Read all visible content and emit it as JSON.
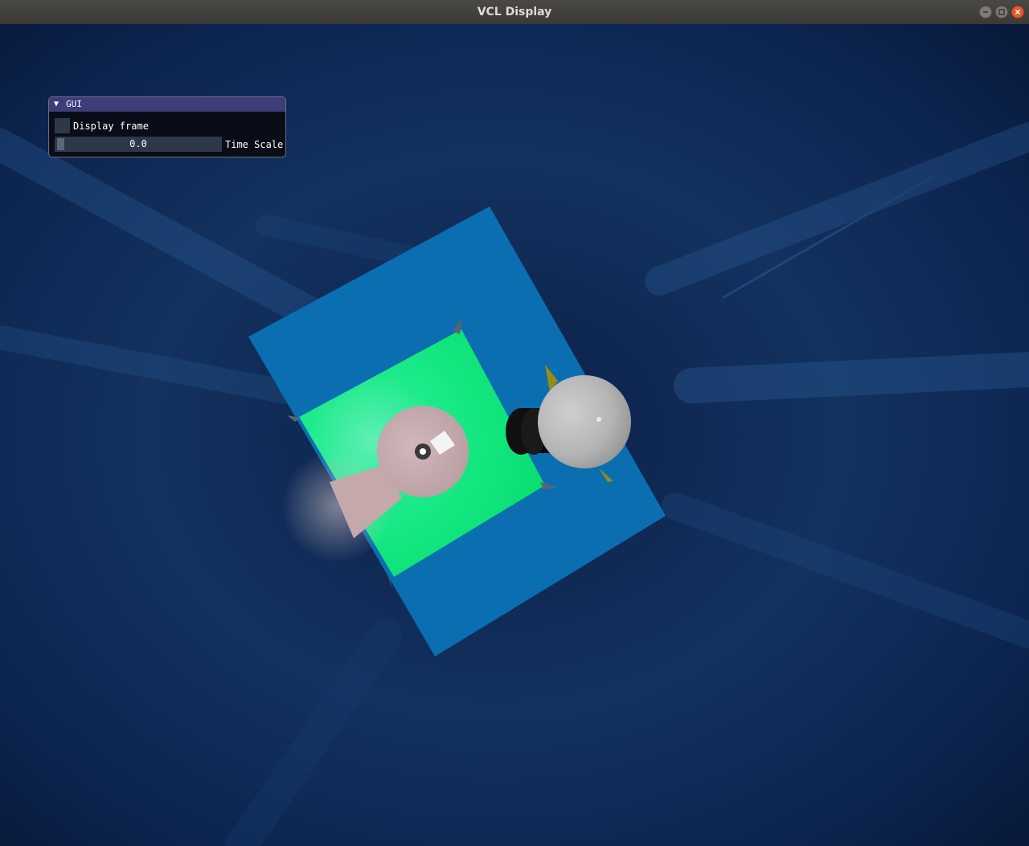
{
  "window": {
    "title": "VCL Display",
    "controls": [
      "minimize-icon",
      "maximize-icon",
      "close-icon"
    ]
  },
  "gui": {
    "title": "GUI",
    "collapse_icon": "▼",
    "display_frame": {
      "label": "Display frame",
      "checked": false
    },
    "time_scale": {
      "label": "Time Scale",
      "value": "0.0"
    }
  },
  "colors": {
    "titlebar": "#3e3d39",
    "close_button": "#e25a2c",
    "gui_header": "#3d3d7a",
    "sky": "#0a1a38",
    "board": "#0a6eb0",
    "field": "#12e07a",
    "pink_disc": "#c4a8aa",
    "cannon": "#101010",
    "wheel": "#b0b0b0"
  }
}
